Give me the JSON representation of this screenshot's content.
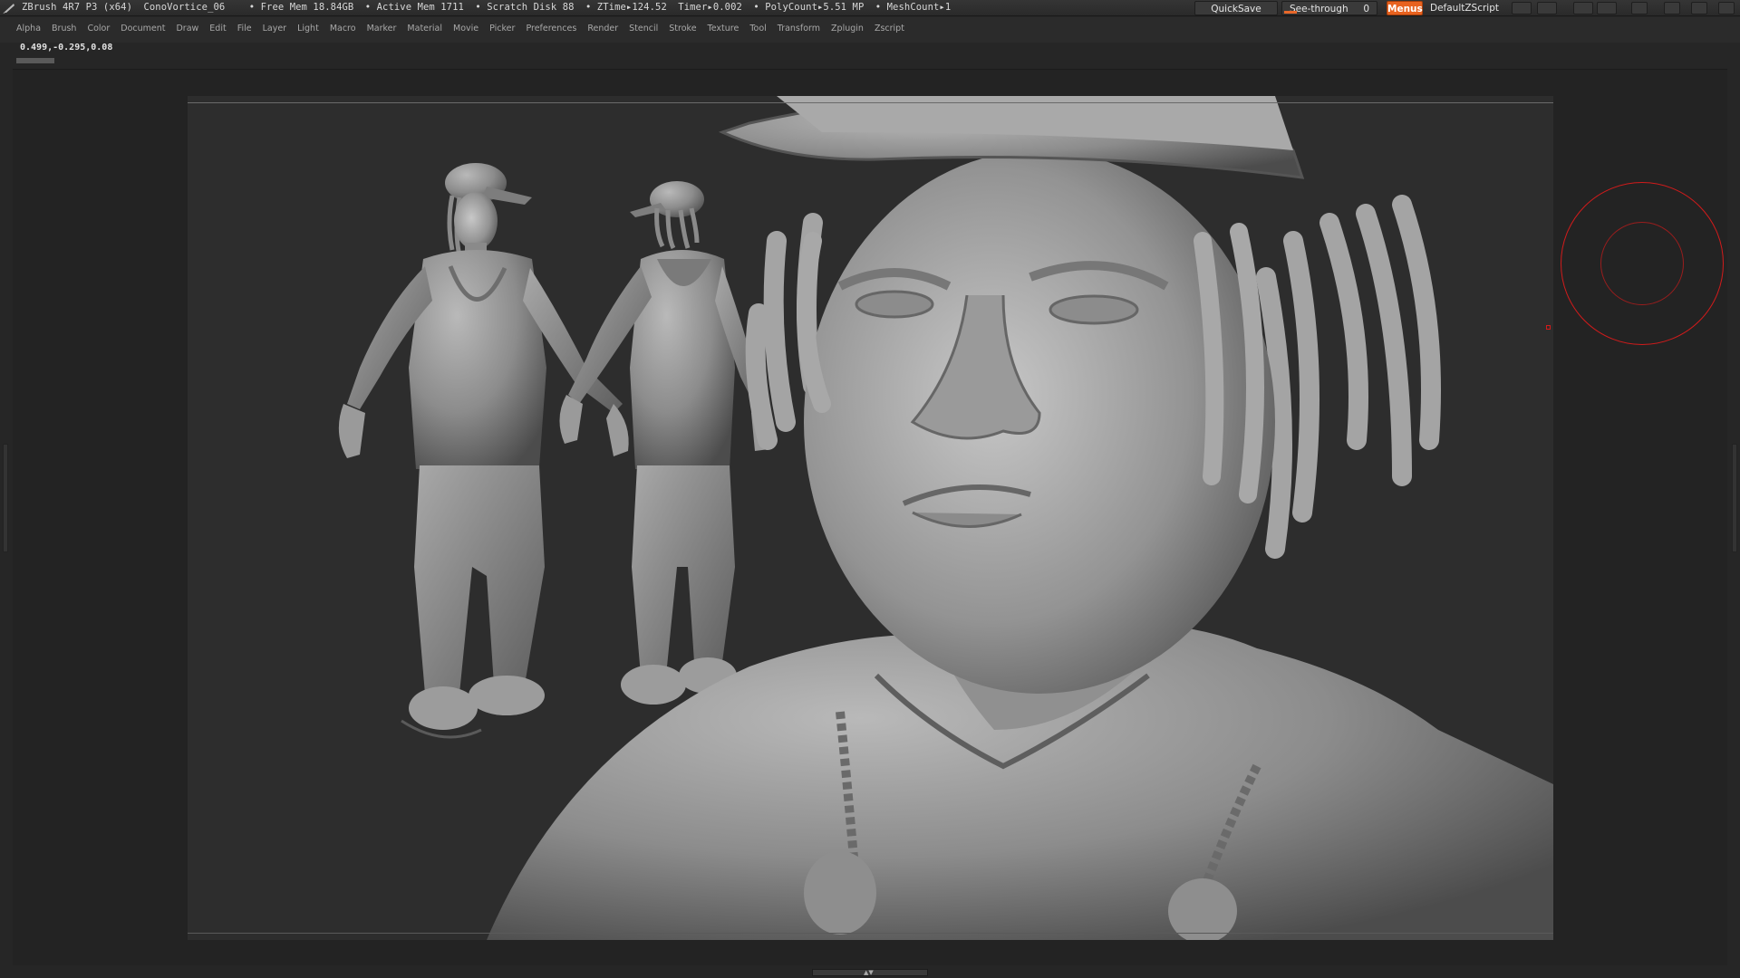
{
  "titlebar": {
    "app": "ZBrush 4R7 P3 (x64)",
    "document": "ConoVortice_06",
    "free_mem": "• Free Mem 18.84GB",
    "active_mem": "• Active Mem 1711",
    "scratch_disk": "• Scratch Disk 88",
    "ztime": "• ZTime▸124.52",
    "timer": "Timer▸0.002",
    "polycount": "• PolyCount▸5.51 MP",
    "meshcount": "• MeshCount▸1",
    "quicksave_label": "QuickSave",
    "seethrough_label": "See-through",
    "seethrough_value": "0",
    "seethrough_level": 0,
    "menus_label": "Menus",
    "script_label": "DefaultZScript",
    "accent_color": "#e8621f"
  },
  "menubar": {
    "items": [
      "Alpha",
      "Brush",
      "Color",
      "Document",
      "Draw",
      "Edit",
      "File",
      "Layer",
      "Light",
      "Macro",
      "Marker",
      "Material",
      "Movie",
      "Picker",
      "Preferences",
      "Render",
      "Stencil",
      "Stroke",
      "Texture",
      "Tool",
      "Transform",
      "Zplugin",
      "Zscript"
    ]
  },
  "status": {
    "coords": "0.499,-0.295,0.08"
  },
  "icons": {
    "logo": "zbrush-logo-icon",
    "brush_cursor": "brush-cursor-icon"
  },
  "brush_color": "#d21b1b"
}
